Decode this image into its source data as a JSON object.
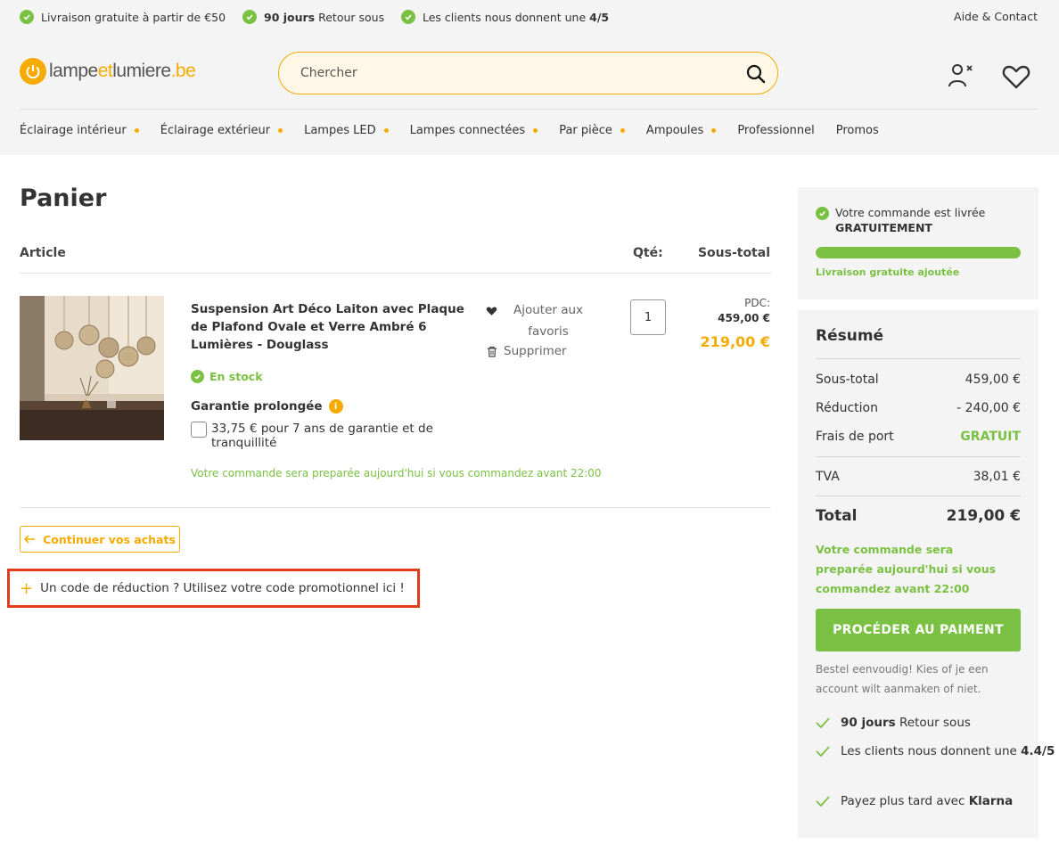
{
  "topbar": {
    "usp1": "Livraison gratuite à partir de €50",
    "usp2_bold": "90 jours",
    "usp2_rest": " Retour sous",
    "usp3_text": "Les clients nous donnent une ",
    "usp3_bold": "4/5",
    "help": "Aide & Contact"
  },
  "header": {
    "logo_part1": "lampe",
    "logo_part2": "et",
    "logo_part3": "lumiere",
    "logo_part4": ".be",
    "search_placeholder": "Chercher"
  },
  "nav": [
    {
      "label": "Éclairage intérieur",
      "dropdown": true
    },
    {
      "label": "Éclairage extérieur",
      "dropdown": true
    },
    {
      "label": "Lampes LED",
      "dropdown": true
    },
    {
      "label": "Lampes connectées",
      "dropdown": true
    },
    {
      "label": "Par pièce",
      "dropdown": true
    },
    {
      "label": "Ampoules",
      "dropdown": true
    },
    {
      "label": "Professionnel",
      "dropdown": false
    },
    {
      "label": "Promos",
      "dropdown": false
    }
  ],
  "cart": {
    "title": "Panier",
    "col_article": "Article",
    "col_qty": "Qté:",
    "col_subtotal": "Sous-total",
    "product": {
      "name": "Suspension Art Déco Laiton avec Plaque de Plafond Ovale et Verre Ambré 6 Lumières - Douglass",
      "stock": "En stock",
      "warranty_label": "Garantie prolongée",
      "warranty_info": "i",
      "warranty_option": "33,75 € pour 7 ans de garantie et de tranquillité",
      "prep_note": "Votre commande sera preparée aujourd'hui si vous commandez avant 22:00",
      "add_fav": "Ajouter aux favoris",
      "delete": "Supprimer",
      "qty": "1",
      "pdc_label": "PDC:",
      "pdc_value": "459,00 €",
      "price": "219,00 €"
    },
    "continue": "Continuer vos achats",
    "promo_plus": "+",
    "promo": "Un code de réduction ? Utilisez votre code promotionnel ici !"
  },
  "shipping": {
    "line1": "Votre commande est livrée",
    "line2": "GRATUITEMENT",
    "progress": 1.0,
    "note": "Livraison gratuite ajoutée"
  },
  "summary": {
    "title": "Résumé",
    "subtotal_label": "Sous-total",
    "subtotal_value": "459,00 €",
    "discount_label": "Réduction",
    "discount_value": "- 240,00 €",
    "shipping_label": "Frais de port",
    "shipping_value": "GRATUIT",
    "vat_label": "TVA",
    "vat_value": "38,01 €",
    "total_label": "Total",
    "total_value": "219,00 €",
    "prep_note": "Votre commande sera preparée aujourd'hui si vous commandez avant 22:00",
    "pay_button": "PROCÉDER AU PAIMENT",
    "bestel": "Bestel eenvoudig! Kies of je een account wilt aanmaken of niet.",
    "perk1_bold": "90 jours",
    "perk1_rest": " Retour sous",
    "perk2_text": "Les clients nous donnent une ",
    "perk2_bold": "4.4/5",
    "perk3_text": "Payez plus tard avec ",
    "perk3_bold": "Klarna"
  },
  "colors": {
    "accent": "#f5ab00",
    "green": "#7ac143",
    "highlight": "#e03c1e",
    "panel": "#f4f4f4"
  },
  "icons": [
    "check-circle-icon",
    "search-icon",
    "user-icon",
    "heart-icon",
    "trash-icon",
    "arrow-left-icon",
    "check-icon",
    "info-icon"
  ]
}
